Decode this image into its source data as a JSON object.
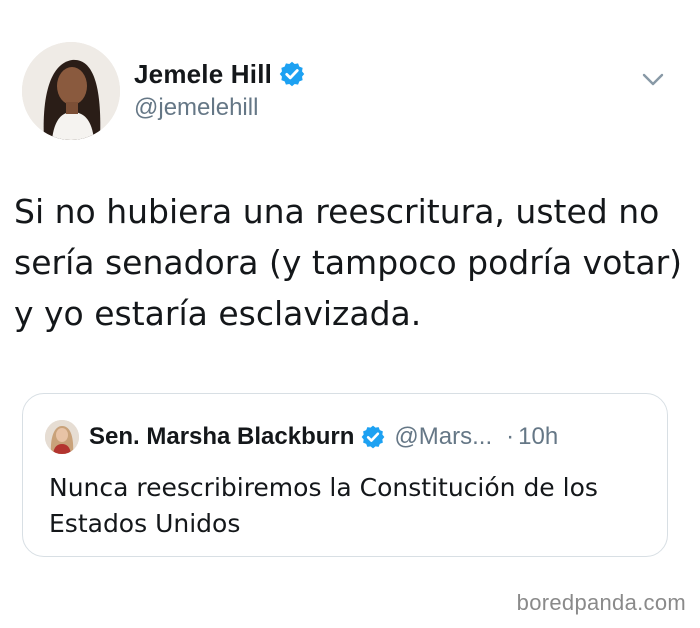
{
  "tweet": {
    "author": {
      "display_name": "Jemele Hill",
      "handle": "@jemelehill",
      "verified": true,
      "avatar_icon": "avatar-photo"
    },
    "menu_icon": "chevron-down-icon",
    "text": "Si no hubiera una reescritura, usted no sería senadora (y tampoco podría votar) y yo estaría esclavizada.",
    "quoted_tweet": {
      "display_name": "Sen. Marsha Blackburn",
      "handle": "@Mars...",
      "separator": "·",
      "time": "10h",
      "verified": true,
      "text": "Nunca reescribiremos la Constitución de los Estados Unidos"
    }
  },
  "watermark": "boredpanda.com",
  "colors": {
    "verified_blue": "#1da1f2",
    "secondary_text": "#657786",
    "border": "#d8dfe4",
    "watermark": "#8a8a8a"
  }
}
